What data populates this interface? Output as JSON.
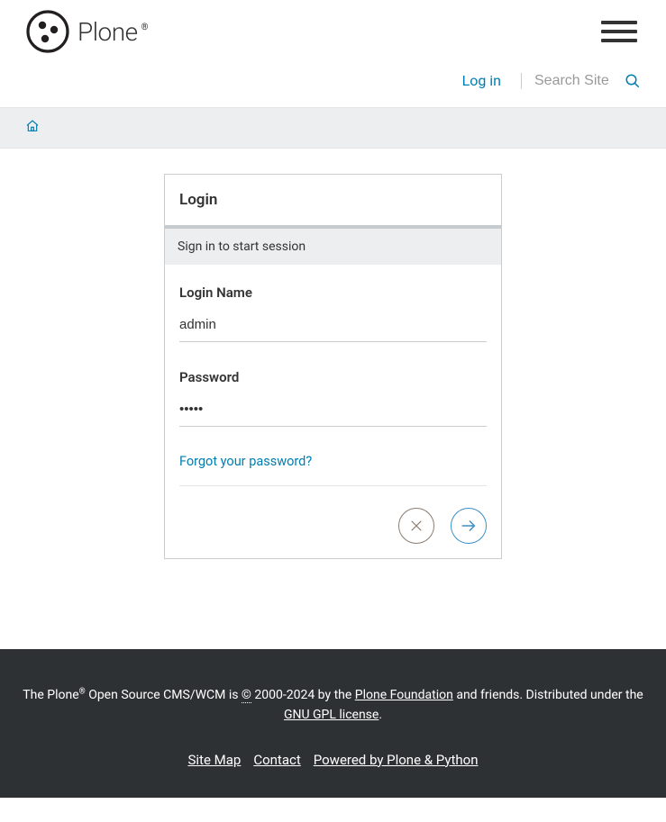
{
  "brand": {
    "name": "Plone"
  },
  "header": {
    "login_link": "Log in",
    "search_placeholder": "Search Site"
  },
  "login_card": {
    "title": "Login",
    "subtitle": "Sign in to start session",
    "login_name_label": "Login Name",
    "login_name_value": "admin",
    "password_label": "Password",
    "password_value": "•••••",
    "forgot": "Forgot your password?"
  },
  "footer": {
    "pre": "The Plone",
    "reg": "®",
    "mid1": " Open Source CMS/WCM is ",
    "copyright_symbol": "©",
    "mid2": " 2000-2024 by the ",
    "foundation": "Plone Foundation",
    "mid3": " and friends. Distributed under the ",
    "license": "GNU GPL license",
    "dot": ".",
    "links": {
      "sitemap": "Site Map",
      "contact": "Contact",
      "powered": "Powered by Plone & Python"
    }
  }
}
